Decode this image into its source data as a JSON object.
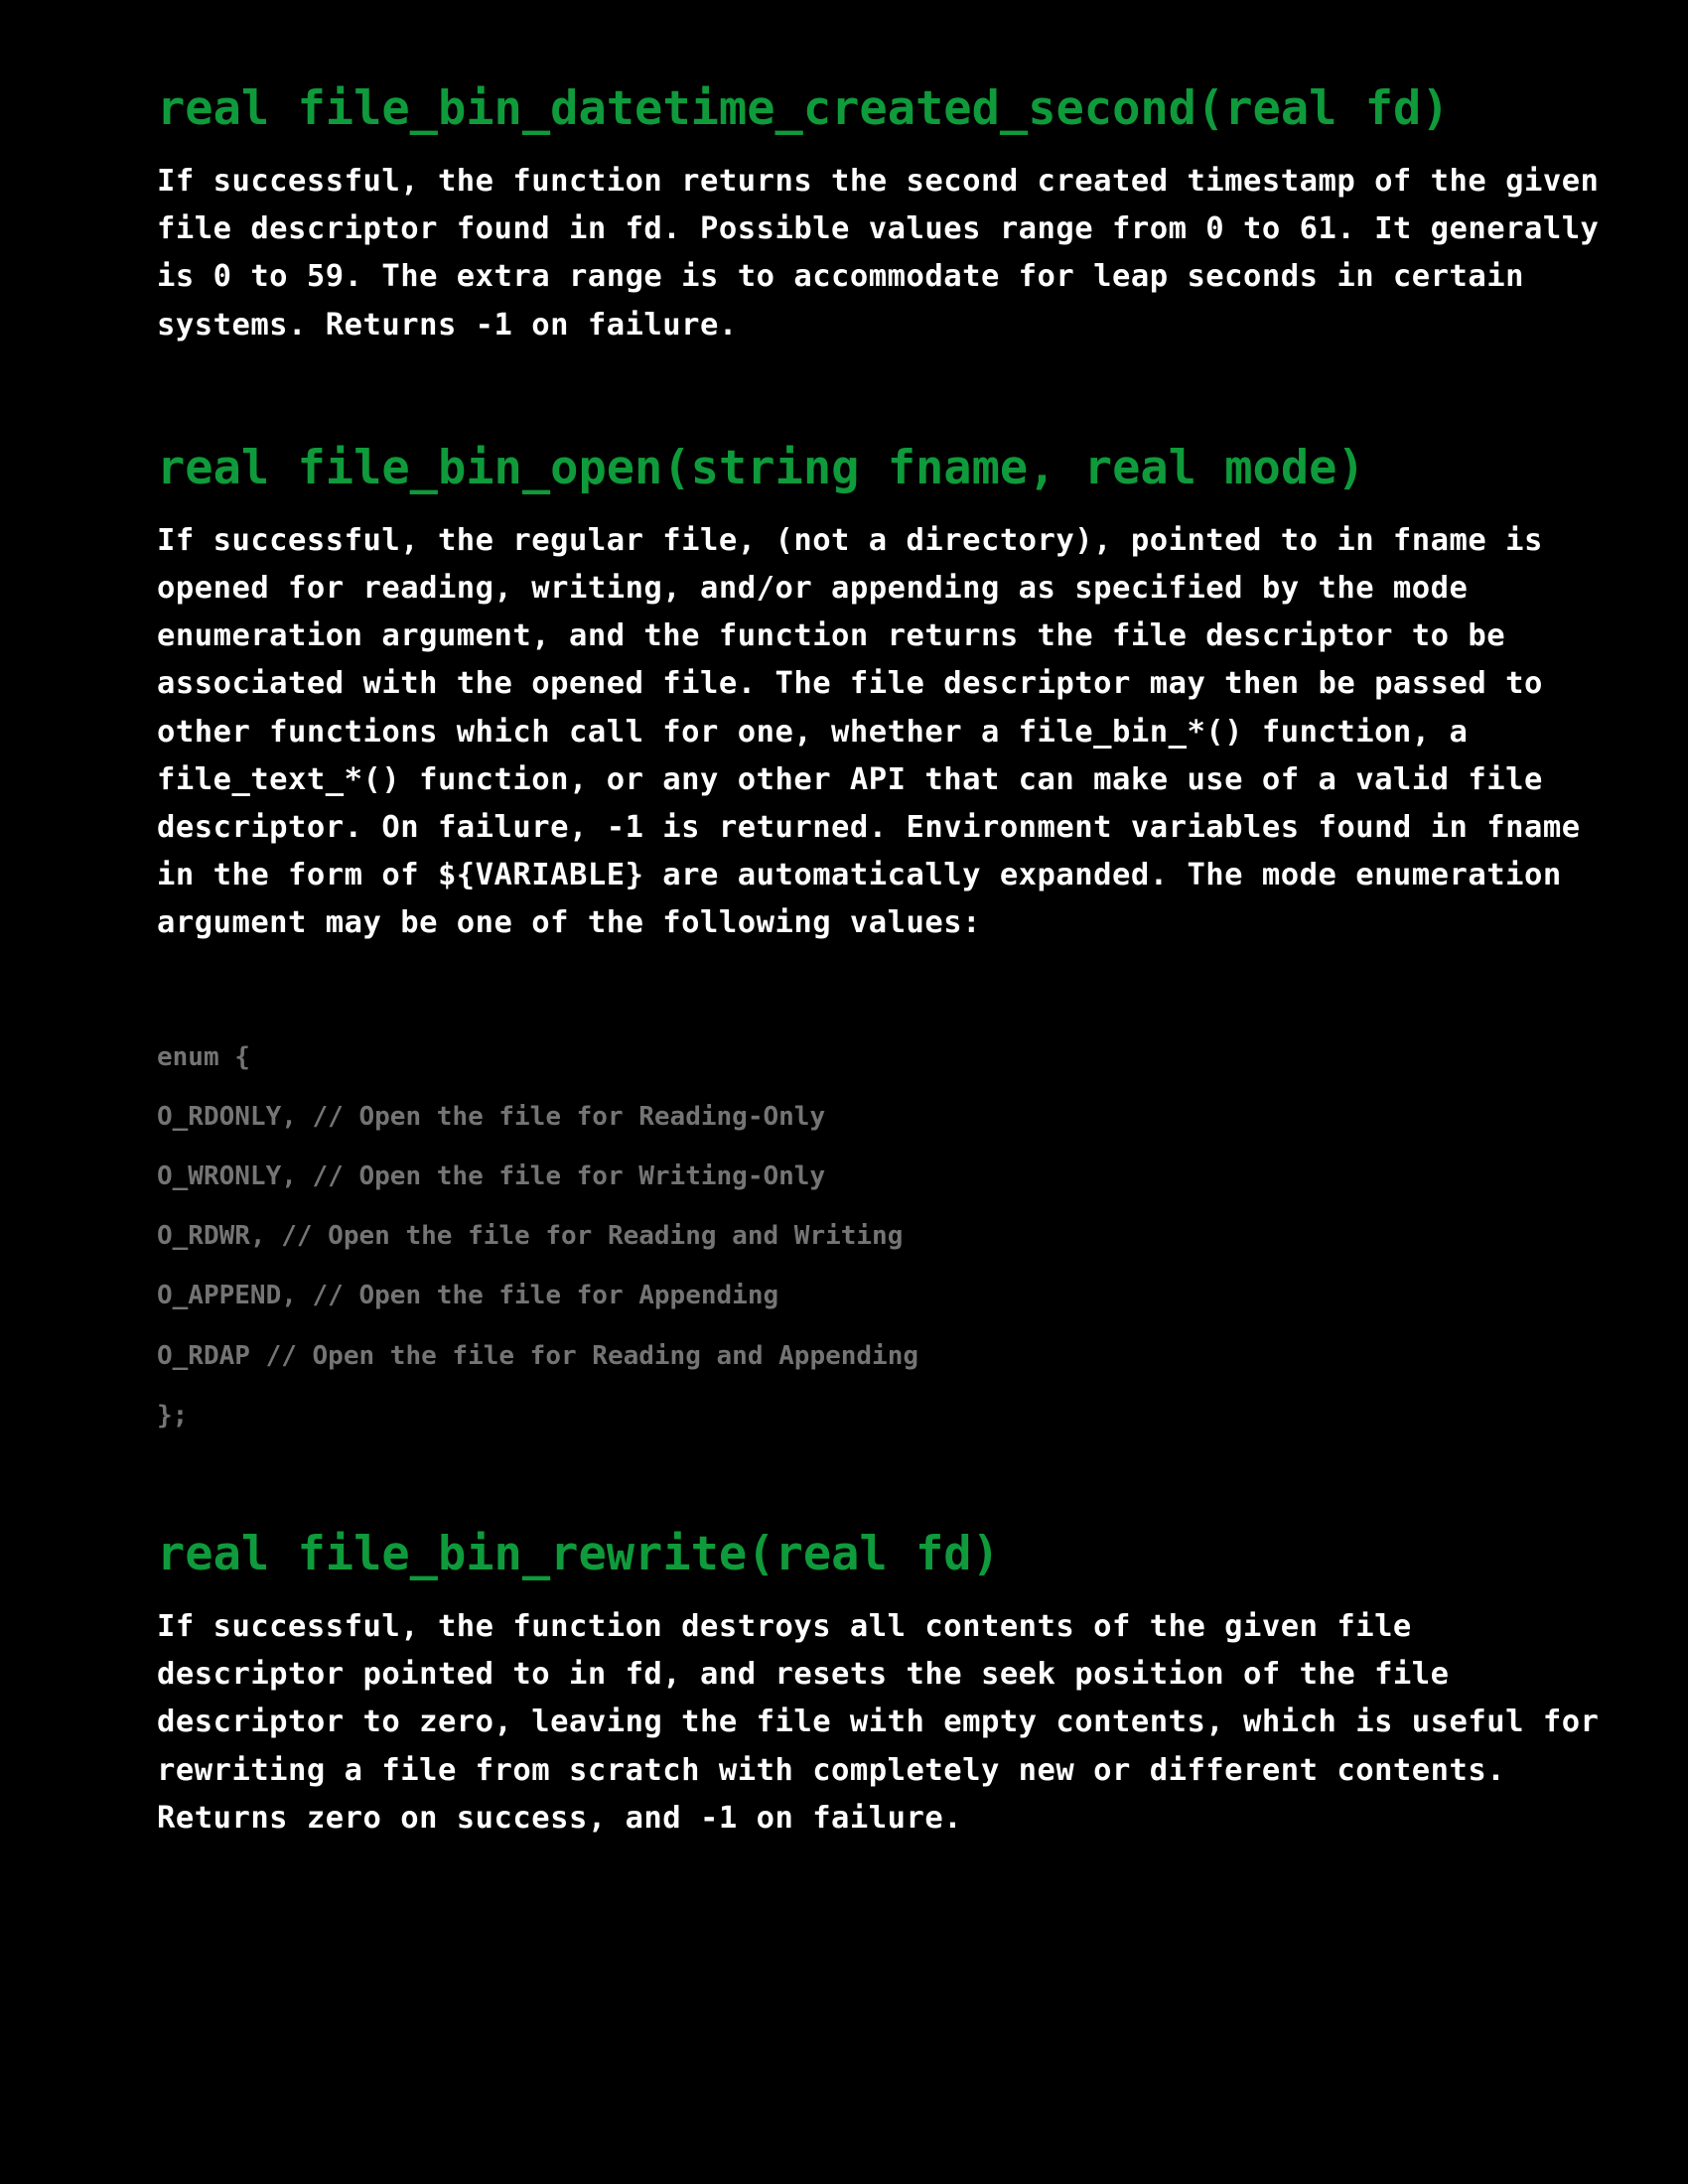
{
  "sections": [
    {
      "signature": "real file_bin_datetime_created_second(real fd)",
      "description": "If successful, the function returns the second created timestamp of the given file descriptor found in fd. Possible values range from 0 to 61. It generally is 0 to 59. The extra range is to accommodate for leap seconds in certain systems. Returns -1 on failure."
    },
    {
      "signature": "real file_bin_open(string fname, real mode)",
      "description": "If successful, the regular file, (not a directory), pointed to in fname is opened for reading, writing, and/or appending as specified by the mode enumeration argument, and the function returns the file descriptor to be associated with the opened file. The file descriptor may then be passed to other functions which call for one, whether a file_bin_*() function, a file_text_*() function, or any other API that can make use of a valid file descriptor. On failure, -1 is returned. Environment variables found in fname in the form of ${VARIABLE} are automatically expanded. The mode enumeration argument may be one of the following values:",
      "code_lines": [
        "enum {",
        "O_RDONLY, // Open the file for Reading-Only",
        "O_WRONLY, // Open the file for Writing-Only",
        "O_RDWR, // Open the file for Reading and Writing",
        "O_APPEND, // Open the file for Appending",
        "O_RDAP // Open the file for Reading and Appending",
        "};"
      ]
    },
    {
      "signature": "real file_bin_rewrite(real fd)",
      "description": "If successful, the function destroys all contents of the given file descriptor pointed to in fd, and resets the seek position of the file descriptor to zero, leaving the file with empty contents, which is useful for rewriting a file from scratch with completely new or different contents. Returns zero on success, and -1 on failure."
    }
  ],
  "colors": {
    "background": "#000000",
    "heading": "#0f9a3b",
    "body_text": "#ffffff",
    "code_text": "#747474"
  }
}
